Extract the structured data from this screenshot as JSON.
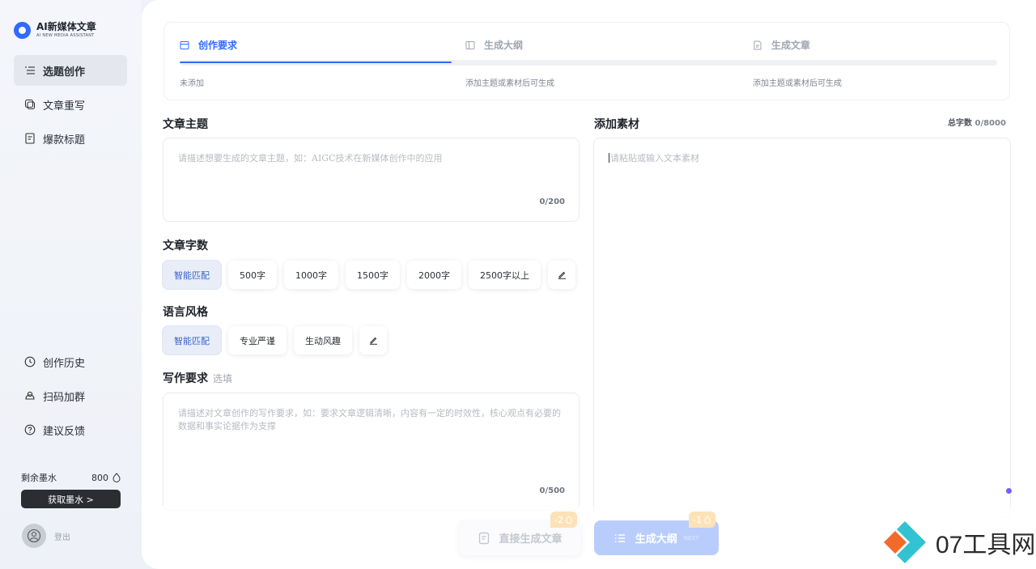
{
  "brand": {
    "name": "AI新媒体文章",
    "sub": "AI NEW MEDIA ASSISTANT"
  },
  "sidebar": {
    "top_items": [
      {
        "label": "选题创作",
        "icon": "list-icon",
        "active": true
      },
      {
        "label": "文章重写",
        "icon": "rewrite-icon"
      },
      {
        "label": "爆款标题",
        "icon": "document-icon"
      }
    ],
    "bottom_items": [
      {
        "label": "创作历史",
        "icon": "clock-icon"
      },
      {
        "label": "扫码加群",
        "icon": "group-icon"
      },
      {
        "label": "建议反馈",
        "icon": "help-icon"
      }
    ],
    "ink_label": "剩余墨水",
    "ink_value": "800",
    "get_ink": "获取墨水 >",
    "logout": "登出"
  },
  "steps": [
    {
      "label": "创作要求",
      "status": "未添加",
      "active": true
    },
    {
      "label": "生成大纲",
      "status": "添加主题或素材后可生成"
    },
    {
      "label": "生成文章",
      "status": "添加主题或素材后可生成"
    }
  ],
  "topic": {
    "title": "文章主题",
    "placeholder": "请描述想要生成的文章主题，如：AIGC技术在新媒体创作中的应用",
    "count": "0/200"
  },
  "wordcount": {
    "title": "文章字数",
    "options": [
      "智能匹配",
      "500字",
      "1000字",
      "1500字",
      "2000字",
      "2500字以上"
    ]
  },
  "style": {
    "title": "语言风格",
    "options": [
      "智能匹配",
      "专业严谨",
      "生动风趣"
    ]
  },
  "requirement": {
    "title": "写作要求",
    "optional": "选填",
    "placeholder": "请描述对文章创作的写作要求，如：要求文章逻辑清晰，内容有一定的时效性，核心观点有必要的数据和事实论据作为支撑",
    "count": "0/500"
  },
  "material": {
    "title": "添加素材",
    "total_label": "总字数",
    "total_value": "0/8000",
    "placeholder": "请粘贴或输入文本素材"
  },
  "actions": {
    "direct": "直接生成文章",
    "direct_cost": "-2",
    "outline": "生成大纲",
    "outline_next": "NEXT",
    "outline_cost": "-1"
  },
  "watermark": "07工具网",
  "colors": {
    "accent": "#2f6bff",
    "selected_chip_bg": "#e8edf8",
    "cost_badge": "#fde2b8"
  }
}
